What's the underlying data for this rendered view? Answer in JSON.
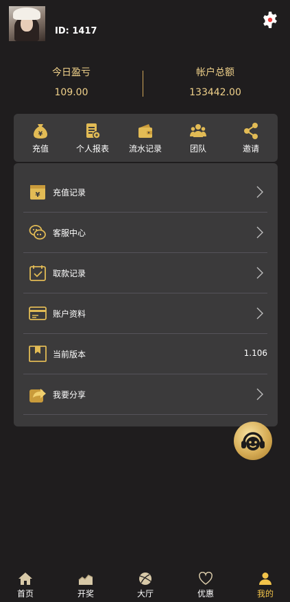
{
  "header": {
    "avatar_alt": "user avatar",
    "id_label": "ID: 1417"
  },
  "stats": {
    "today_profit_label": "今日盈亏",
    "today_profit_value": "109.00",
    "total_label": "帐户总额",
    "total_value": "133442.00"
  },
  "quick": [
    {
      "label": "充值",
      "icon": "money-bag-icon"
    },
    {
      "label": "个人报表",
      "icon": "report-icon"
    },
    {
      "label": "流水记录",
      "icon": "wallet-icon"
    },
    {
      "label": "团队",
      "icon": "team-icon"
    },
    {
      "label": "邀请",
      "icon": "share-icon"
    }
  ],
  "menu": [
    {
      "label": "充值记录",
      "icon": "recharge-record-icon"
    },
    {
      "label": "客服中心",
      "icon": "chat-icon"
    },
    {
      "label": "取款记录",
      "icon": "calendar-check-icon"
    },
    {
      "label": "账户资料",
      "icon": "card-icon"
    },
    {
      "label": "当前版本",
      "icon": "bookmark-icon",
      "value": "1.106"
    },
    {
      "label": "我要分享",
      "icon": "share-arrow-icon"
    }
  ],
  "tabs": [
    {
      "label": "首页",
      "icon": "home-icon"
    },
    {
      "label": "开奖",
      "icon": "chart-icon"
    },
    {
      "label": "大厅",
      "icon": "ball-icon"
    },
    {
      "label": "优惠",
      "icon": "heart-icon"
    },
    {
      "label": "我的",
      "icon": "user-icon",
      "active": true
    }
  ],
  "colors": {
    "background": "#1f1d1e",
    "panel": "#3b3a3b",
    "gold": "#f1d28b",
    "accent": "#f2c34a"
  }
}
